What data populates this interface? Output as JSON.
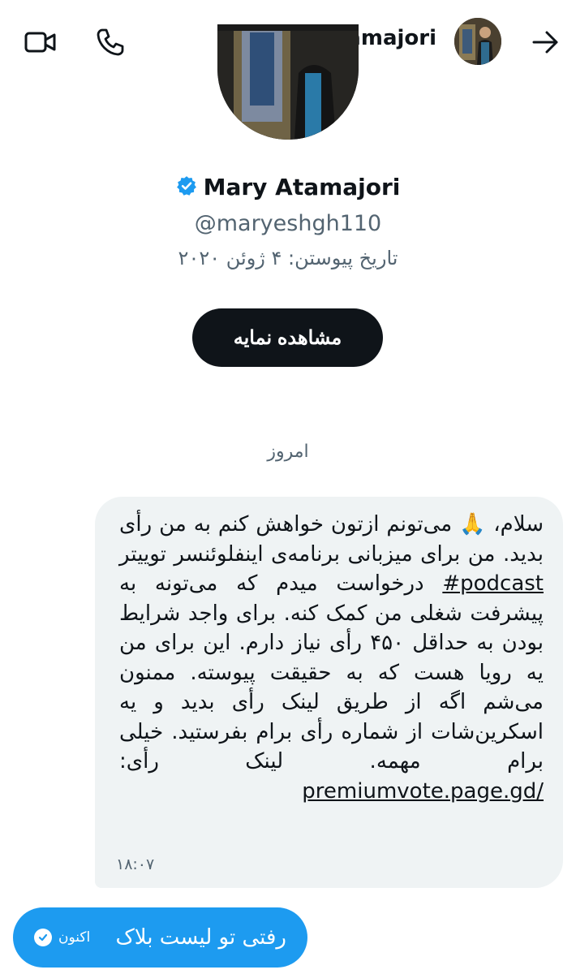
{
  "header": {
    "display_name": "Mary Atamajori",
    "icons": [
      "video-call-icon",
      "phone-call-icon",
      "verified-badge-icon",
      "avatar",
      "back-arrow-icon"
    ]
  },
  "profile": {
    "display_name": "Mary Atamajori",
    "handle": "@maryeshgh110",
    "joined": "تاریخ پیوستن: ۴ ژوئن ۲۰۲۰",
    "view_profile_label": "مشاهده نمایه"
  },
  "conversation": {
    "day_label": "امروز",
    "incoming_message": {
      "text_before_hashtag": "سلام، 🙏 می‌تونم ازتون خواهش کنم به من رأی بدید. من برای میزبانی برنامه‌ی اینفلوئنسر توییتر ",
      "hashtag": "#podcast",
      "text_after_hashtag": " درخواست میدم که می‌تونه به پیشرفت شغلی من کمک کنه. برای واجد شرایط بودن به حداقل ۴۵۰ رأی نیاز دارم. این برای من یه رویا هست که به حقیقت پیوسته. ممنون می‌شم اگه از طریق لینک رأی بدید و یه اسکرین‌شات از شماره رأی برام بفرستید. خیلی برام مهمه. لینک رأی: ",
      "link": "premiumvote.page.gd/",
      "time": "۱۸:۰۷"
    },
    "outgoing_message": {
      "text": "رفتی تو لیست بلاک",
      "status": "اکنون"
    }
  },
  "colors": {
    "accent": "#1d9bf0",
    "incoming_bubble": "#eff3f4",
    "primary_text": "#0f1419",
    "secondary_text": "#536471"
  }
}
